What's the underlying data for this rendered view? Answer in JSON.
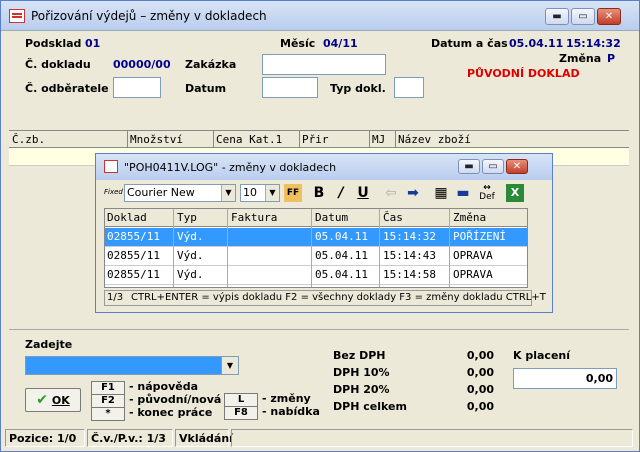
{
  "window": {
    "title": "Pořizování výdejů – změny v dokladech",
    "min": "▬",
    "max": "▭",
    "close": "✕"
  },
  "header": {
    "podsklad_label": "Podsklad",
    "podsklad_value": "01",
    "mesic_label": "Měsíc",
    "mesic_value": "04/11",
    "datum_cas_label": "Datum a čas",
    "datum_value": "05.04.11",
    "cas_value": "15:14:32",
    "zmena_label": "Změna",
    "zmena_value": "P",
    "dokladu_label": "Č. dokladu",
    "dokladu_value": "00000/00",
    "zakazka_label": "Zakázka",
    "puvodni_doklad": "PŮVODNÍ DOKLAD",
    "odberatele_label": "Č. odběratele",
    "datum_label": "Datum",
    "typ_label": "Typ dokl."
  },
  "grid": {
    "columns": [
      "Č.zb.",
      "Množství",
      "Cena Kat.1",
      "Přir",
      "MJ",
      "Název zboží"
    ]
  },
  "dialog": {
    "title": "\"POH0411V.LOG\" - změny v dokladech",
    "fixed_label": "Fixed",
    "font_name": "Courier New",
    "font_size": "10",
    "columns": [
      "Doklad",
      "Typ",
      "Faktura",
      "Datum",
      "Čas",
      "Změna"
    ],
    "rows": [
      {
        "doklad": "02855/11",
        "typ": "Výd.",
        "faktura": "",
        "datum": "05.04.11",
        "cas": "15:14:32",
        "zmena": "POŘÍZENÍ"
      },
      {
        "doklad": "02855/11",
        "typ": "Výd.",
        "faktura": "",
        "datum": "05.04.11",
        "cas": "15:14:43",
        "zmena": "OPRAVA"
      },
      {
        "doklad": "02855/11",
        "typ": "Výd.",
        "faktura": "",
        "datum": "05.04.11",
        "cas": "15:14:58",
        "zmena": "OPRAVA"
      }
    ],
    "status_count": "1/3",
    "status_text": "CTRL+ENTER = výpis dokladu F2 = všechny doklady F3 = změny dokladu CTRL+T",
    "def_label": "Def"
  },
  "bottom": {
    "zadejte_label": "Zadejte",
    "ok_label": "OK",
    "keys": [
      {
        "key": "F1",
        "desc": "- nápověda"
      },
      {
        "key": "F2",
        "desc": "- původní/nová"
      },
      {
        "key": "*",
        "desc": "- konec práce"
      }
    ],
    "keys2": [
      {
        "key": "L",
        "desc": "- změny"
      },
      {
        "key": "F8",
        "desc": "- nabídka"
      }
    ],
    "bez_dph_label": "Bez DPH",
    "bez_dph": "0,00",
    "dph10_label": "DPH 10%",
    "dph10": "0,00",
    "dph20_label": "DPH 20%",
    "dph20": "0,00",
    "dph_celkem_label": "DPH celkem",
    "dph_celkem": "0,00",
    "k_placeni_label": "K placení",
    "k_placeni": "0,00"
  },
  "status": {
    "pozice": "Pozice: 1/0",
    "cv": "Č.v./P.v.: 1/3",
    "mode": "Vkládání"
  }
}
